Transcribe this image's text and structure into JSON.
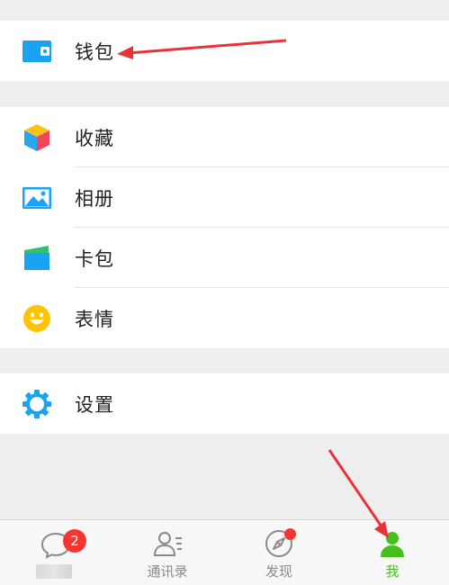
{
  "groups": {
    "wallet": {
      "label": "钱包",
      "icon": "wallet-icon"
    },
    "main": [
      {
        "label": "收藏",
        "icon": "favorites-cube-icon"
      },
      {
        "label": "相册",
        "icon": "album-picture-icon"
      },
      {
        "label": "卡包",
        "icon": "card-wallet-icon"
      },
      {
        "label": "表情",
        "icon": "smiley-icon"
      }
    ],
    "settings": {
      "label": "设置",
      "icon": "gear-icon"
    }
  },
  "tabbar": {
    "chats": {
      "badge": "2",
      "icon": "chat-bubble-icon"
    },
    "contacts": {
      "label": "通讯录",
      "icon": "contacts-icon"
    },
    "discover": {
      "label": "发现",
      "icon": "compass-icon",
      "has_dot": true
    },
    "me": {
      "label": "我",
      "icon": "person-icon",
      "active": true
    }
  },
  "colors": {
    "accent_green": "#45c01a",
    "badge_red": "#f43530",
    "blue": "#1aa3f2",
    "arrow_red": "#e8323a"
  }
}
